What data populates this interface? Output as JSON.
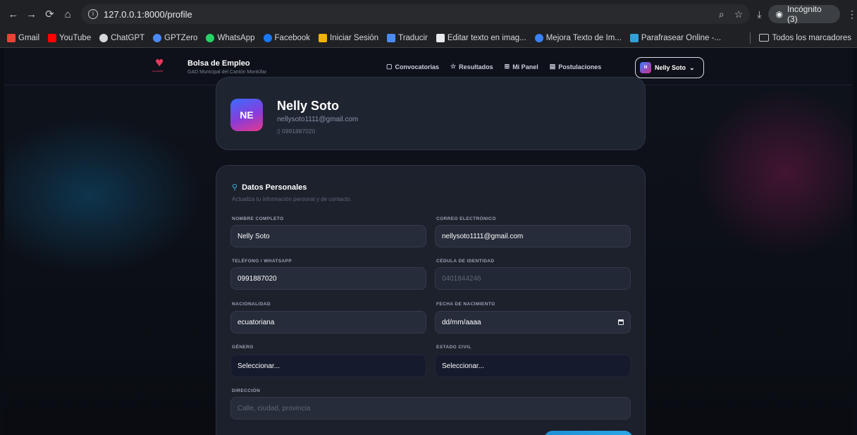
{
  "browser": {
    "url": "127.0.0.1:8000/profile",
    "incognito_label": "Incógnito (3)",
    "bookmarks": [
      "Gmail",
      "YouTube",
      "ChatGPT",
      "GPTZero",
      "WhatsApp",
      "Facebook",
      "Iniciar Sesión",
      "Traducir",
      "Editar texto en imag...",
      "Mejora Texto de Im...",
      "Parafrasear Online -..."
    ],
    "all_bookmarks_label": "Todos los marcadores"
  },
  "header": {
    "brand_title": "Bolsa de Empleo",
    "brand_subtitle": "GAD Municipal del Cantón Montúfar",
    "logo_text": "montufar",
    "nav": [
      "Convocatorias",
      "Resultados",
      "Mi Panel",
      "Postulaciones"
    ],
    "user_initial": "N",
    "user_name": "Nelly Soto"
  },
  "profile": {
    "initials": "NE",
    "name": "Nelly Soto",
    "email": "nellysoto1111@gmail.com",
    "phone": "0991887020"
  },
  "form": {
    "section_title": "Datos Personales",
    "section_subtitle": "Actualiza tu información personal y de contacto.",
    "fields": {
      "full_name": {
        "label": "NOMBRE COMPLETO",
        "value": "Nelly Soto"
      },
      "email": {
        "label": "CORREO ELECTRÓNICO",
        "value": "nellysoto1111@gmail.com"
      },
      "phone": {
        "label": "TELÉFONO / WHATSAPP",
        "value": "0991887020"
      },
      "id_card": {
        "label": "CÉDULA DE IDENTIDAD",
        "value": "0401844246"
      },
      "nationality": {
        "label": "NACIONALIDAD",
        "value": "ecuatoriana"
      },
      "birthdate": {
        "label": "FECHA DE NACIMIENTO",
        "value": "dd/mm/aaaa"
      },
      "gender": {
        "label": "GÉNERO",
        "value": "Seleccionar..."
      },
      "civil_status": {
        "label": "ESTADO CIVIL",
        "value": "Seleccionar..."
      },
      "address": {
        "label": "DIRECCIÓN",
        "placeholder": "Calle, ciudad, provincia"
      }
    }
  },
  "colors": {
    "accent": "#2aa6e6",
    "brand_red": "#e43a5c",
    "page_bg": "#0b0d14"
  }
}
